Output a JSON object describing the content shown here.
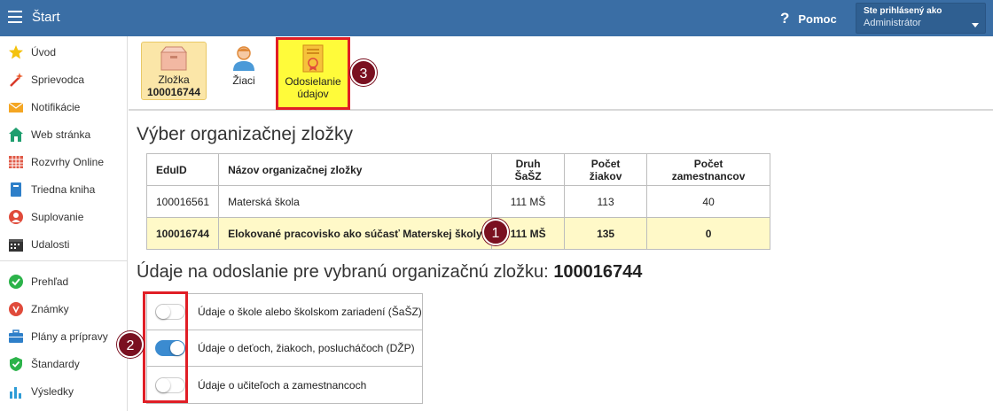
{
  "topbar": {
    "title": "Štart",
    "help_label": "Pomoc",
    "help_icon": "question-icon",
    "user_label": "Ste prihlásený ako",
    "user_name": "Administrátor"
  },
  "sidebar": {
    "items": [
      {
        "label": "Úvod",
        "icon": "star-icon"
      },
      {
        "label": "Sprievodca",
        "icon": "magic-wand-icon"
      },
      {
        "label": "Notifikácie",
        "icon": "envelope-icon"
      },
      {
        "label": "Web stránka",
        "icon": "home-icon"
      },
      {
        "label": "Rozvrhy Online",
        "icon": "timetable-icon"
      },
      {
        "label": "Triedna kniha",
        "icon": "book-icon"
      },
      {
        "label": "Suplovanie",
        "icon": "substitute-user-icon"
      },
      {
        "label": "Udalosti",
        "icon": "calendar-icon"
      },
      {
        "label": "Prehľad",
        "icon": "check-circle-icon"
      },
      {
        "label": "Známky",
        "icon": "grades-icon"
      },
      {
        "label": "Plány a prípravy",
        "icon": "briefcase-icon"
      },
      {
        "label": "Štandardy",
        "icon": "shield-check-icon"
      },
      {
        "label": "Výsledky",
        "icon": "bar-chart-icon"
      }
    ]
  },
  "toolbar": {
    "folder_label": "Zložka",
    "folder_id": "100016744",
    "students_label": "Žiaci",
    "send_label_line1": "Odosielanie",
    "send_label_line2": "údajov"
  },
  "markers": [
    "1",
    "2",
    "3"
  ],
  "main": {
    "select_title": "Výber organizačnej zložky",
    "table": {
      "headers": [
        "EduID",
        "Názov organizačnej zložky",
        "Druh ŠaŠZ",
        "Počet žiakov",
        "Počet zamestnancov"
      ],
      "rows": [
        [
          "100016561",
          "Materská škola",
          "111 MŠ",
          "113",
          "40"
        ],
        [
          "100016744",
          "Elokované pracovisko ako súčasť Materskej školy",
          "111 MŠ",
          "135",
          "0"
        ]
      ],
      "selected_row": 1
    },
    "data_title_prefix": "Údaje na odoslanie pre vybranú organizačnú zložku:",
    "data_title_id": "100016744",
    "toggles": [
      {
        "label": "Údaje o škole alebo školskom zariadení (ŠaŠZ)",
        "on": false
      },
      {
        "label": "Údaje o deťoch, žiakoch, poslucháčoch (DŽP)",
        "on": true
      },
      {
        "label": "Údaje o učiteľoch a zamestnancoch",
        "on": false
      }
    ]
  },
  "colors": {
    "topbar": "#3a6ea5",
    "highlight_box": "#e01e26",
    "selected_row": "#fff9c8",
    "toggle_on": "#3b8bd0",
    "marker": "#7a1020"
  }
}
